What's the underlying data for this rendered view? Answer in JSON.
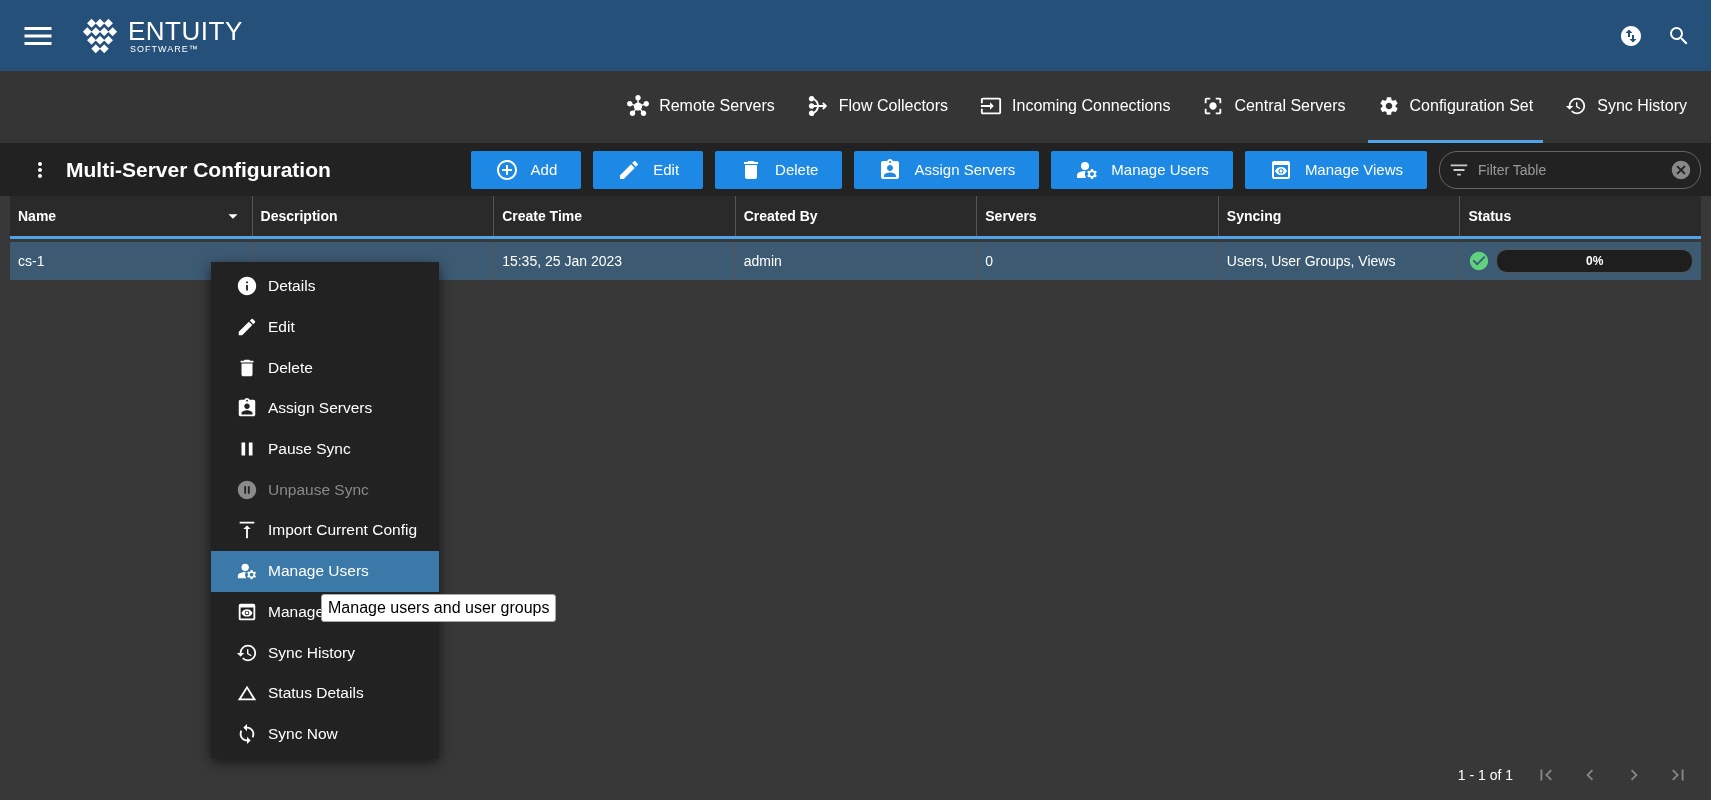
{
  "header": {
    "logo": {
      "name": "ENTUITY",
      "tagline": "SOFTWARE™"
    }
  },
  "tabs": [
    {
      "label": "Remote Servers",
      "selected": false
    },
    {
      "label": "Flow Collectors",
      "selected": false
    },
    {
      "label": "Incoming Connections",
      "selected": false
    },
    {
      "label": "Central Servers",
      "selected": false
    },
    {
      "label": "Configuration Set",
      "selected": true
    },
    {
      "label": "Sync History",
      "selected": false
    }
  ],
  "toolbar": {
    "title": "Multi-Server Configuration",
    "buttons": [
      "Add",
      "Edit",
      "Delete",
      "Assign Servers",
      "Manage Users",
      "Manage Views"
    ],
    "filter": {
      "placeholder": "Filter Table"
    }
  },
  "table": {
    "columns": [
      {
        "label": "Name",
        "sorted": true
      },
      {
        "label": "Description",
        "sorted": false
      },
      {
        "label": "Create Time",
        "sorted": false
      },
      {
        "label": "Created By",
        "sorted": false
      },
      {
        "label": "Servers",
        "sorted": false
      },
      {
        "label": "Syncing",
        "sorted": false
      },
      {
        "label": "Status",
        "sorted": false
      }
    ],
    "rows": [
      {
        "selected": true,
        "cells": [
          "cs-1",
          "",
          "15:35, 25 Jan 2023",
          "admin",
          "0",
          "Users, User Groups, Views"
        ],
        "status": {
          "synced": true,
          "reading": "0%"
        }
      }
    ]
  },
  "context_menu": {
    "items": [
      {
        "label": "Details",
        "selected": false,
        "disabled": false
      },
      {
        "label": "Edit",
        "selected": false,
        "disabled": false
      },
      {
        "label": "Delete",
        "selected": false,
        "disabled": false
      },
      {
        "label": "Assign Servers",
        "selected": false,
        "disabled": false
      },
      {
        "label": "Pause Sync",
        "selected": false,
        "disabled": false
      },
      {
        "label": "Unpause Sync",
        "selected": false,
        "disabled": true
      },
      {
        "label": "Import Current Config",
        "selected": false,
        "disabled": false
      },
      {
        "label": "Manage Users",
        "selected": true,
        "disabled": false
      },
      {
        "label": "Manage",
        "selected": false,
        "disabled": false
      },
      {
        "label": "Sync History",
        "selected": false,
        "disabled": false
      },
      {
        "label": "Status Details",
        "selected": false,
        "disabled": false
      },
      {
        "label": "Sync Now",
        "selected": false,
        "disabled": false
      }
    ],
    "tooltip": "Manage users and user groups"
  },
  "pagination": {
    "range": "1 - 1 of 1"
  }
}
